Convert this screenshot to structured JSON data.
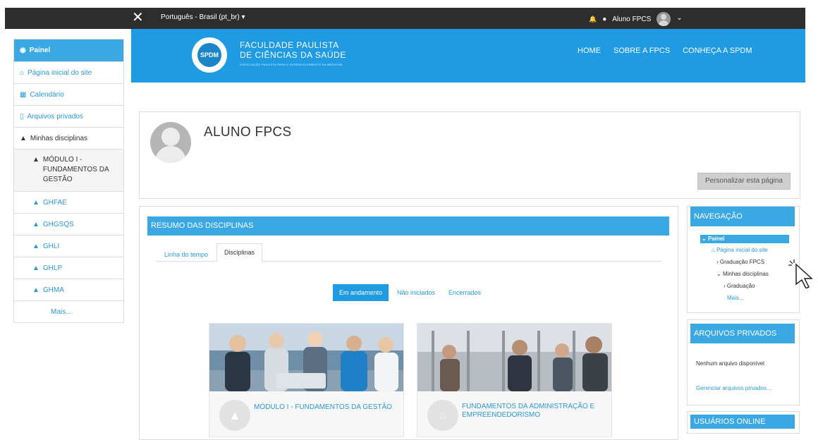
{
  "topbar": {
    "close_glyph": "✕",
    "language": "Português - Brasil (pt_br) ▾",
    "bell_icon": "🔔",
    "chat_icon": "●",
    "username": "Aluno FPCS",
    "user_menu_chevron": "⌄"
  },
  "sidebar": {
    "items": [
      {
        "label": "Painel"
      },
      {
        "label": "Página inicial do site"
      },
      {
        "label": "Calendário"
      },
      {
        "label": "Arquivos privados"
      },
      {
        "label": "Minhas disciplinas"
      },
      {
        "label": "MÓDULO I - FUNDAMENTOS DA GESTÃO"
      },
      {
        "label": "GHFAE"
      },
      {
        "label": "GHGSQS"
      },
      {
        "label": "GHLI"
      },
      {
        "label": "GHLP"
      },
      {
        "label": "GHMA"
      },
      {
        "label": "Mais..."
      }
    ]
  },
  "header": {
    "logo_text": "SPDM",
    "brand_line1": "FACULDADE PAULISTA",
    "brand_line2": "DE CIÊNCIAS DA SAÚDE",
    "brand_line3": "ASSOCIAÇÃO PAULISTA PARA O DESENVOLVIMENTO DA MEDICINA",
    "nav": [
      "HOME",
      "SOBRE A FPCS",
      "CONHEÇA A SPDM"
    ]
  },
  "profile": {
    "name": "ALUNO FPCS",
    "customize_button": "Personalizar esta página"
  },
  "resumo": {
    "title": "RESUMO DAS DISCIPLINAS",
    "tabs": [
      "Linha do tempo",
      "Disciplinas"
    ],
    "filters": [
      "Em andamento",
      "Não iniciados",
      "Encerrados"
    ],
    "cards": [
      {
        "title": "MÓDULO I - FUNDAMENTOS DA GESTÃO"
      },
      {
        "title": "FUNDAMENTOS DA ADMINISTRAÇÃO E EMPREENDEDORISMO"
      }
    ]
  },
  "navegacao": {
    "title": "NAVEGAÇÃO",
    "root": "Painel",
    "items": [
      "Página inicial do site",
      "Graduação FPCS",
      "Minhas disciplinas",
      "Graduação",
      "Mais..."
    ]
  },
  "arquivos": {
    "title": "ARQUIVOS PRIVADOS",
    "empty": "Nenhum arquivo disponível",
    "manage": "Gerenciar arquivos privados..."
  },
  "usuarios": {
    "title": "USUÁRIOS ONLINE"
  },
  "colors": {
    "accent": "#3aa9e3",
    "banner": "#1e9be2",
    "topbar": "#2d2d2d",
    "link": "#2a9ad6"
  }
}
